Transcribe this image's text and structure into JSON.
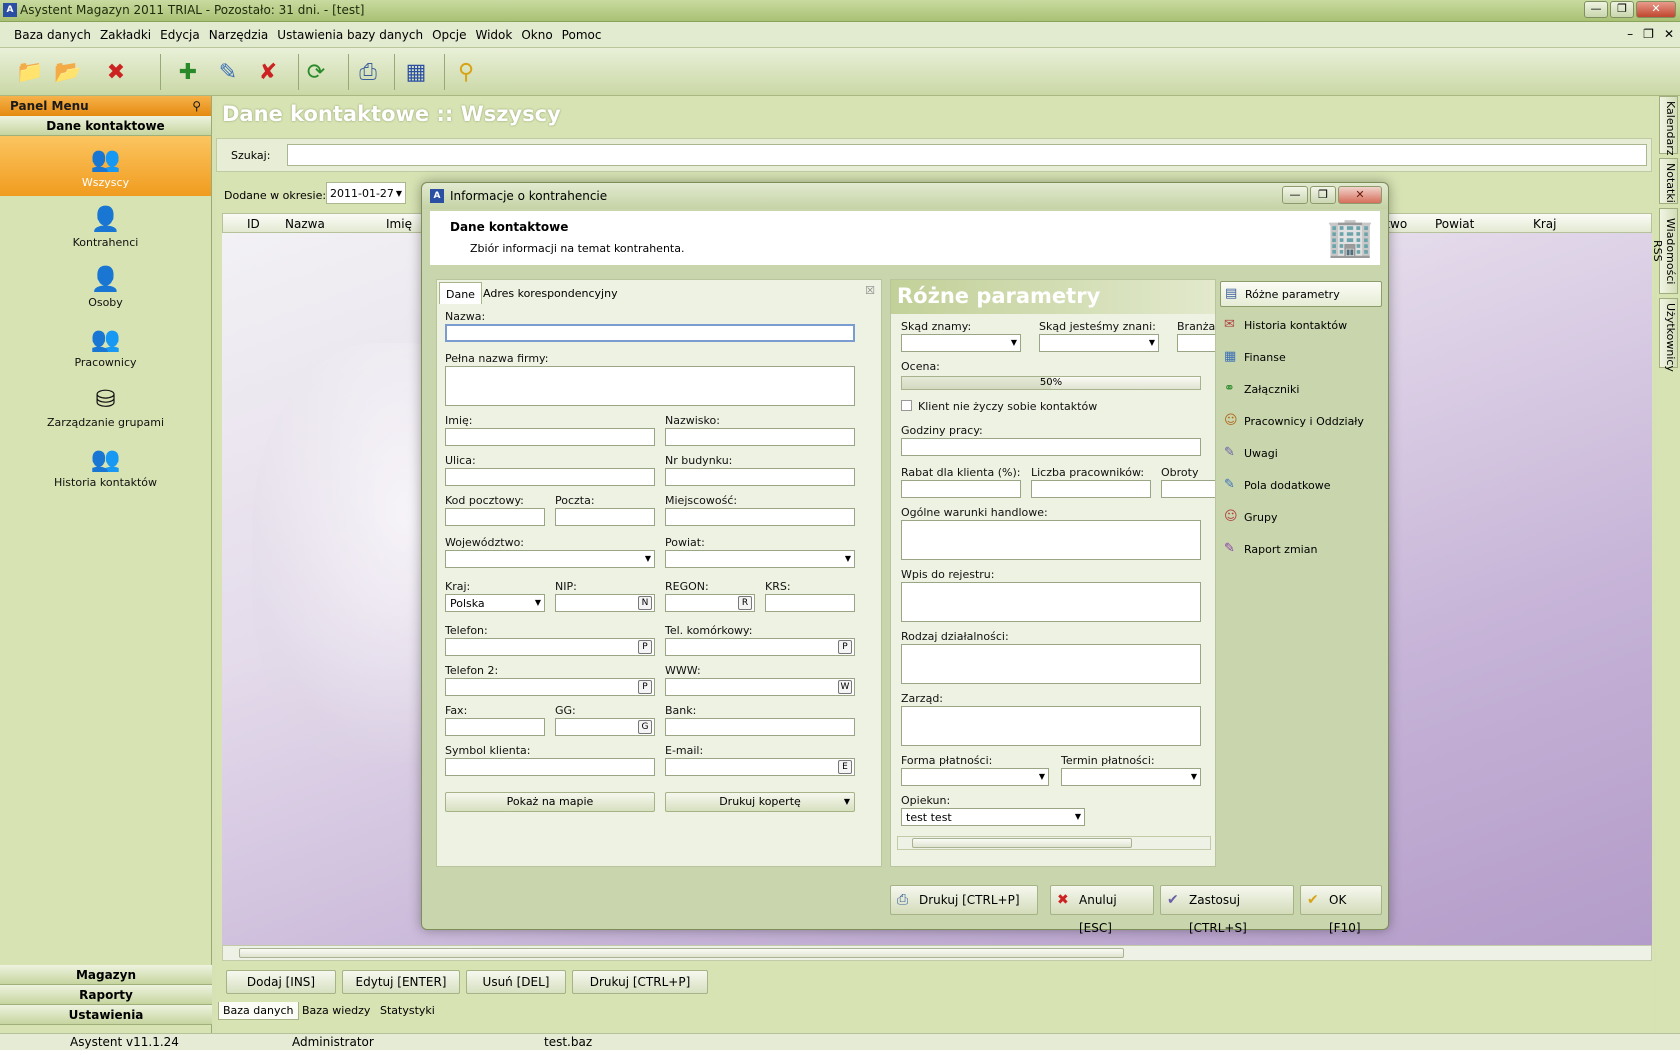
{
  "window": {
    "title": "Asystent Magazyn 2011 TRIAL - Pozostało: 31 dni. - [test]",
    "icon_letter": "A"
  },
  "menu": [
    "Baza danych",
    "Zakładki",
    "Edycja",
    "Narzędzia",
    "Ustawienia bazy danych",
    "Opcje",
    "Widok",
    "Okno",
    "Pomoc"
  ],
  "panel": {
    "title": "Panel Menu",
    "section": "Dane kontaktowe",
    "items": [
      "Wszyscy",
      "Kontrahenci",
      "Osoby",
      "Pracownicy",
      "Zarządzanie grupami",
      "Historia kontaktów"
    ],
    "bottom_sections": [
      "Magazyn",
      "Raporty",
      "Ustawienia"
    ]
  },
  "main": {
    "title": "Dane kontaktowe :: Wszyscy",
    "search_label": "Szukaj:",
    "date_label": "Dodane w okresie:",
    "date_value": "2011-01-27",
    "columns": [
      "ID",
      "Nazwa",
      "Imię",
      "Województwo",
      "Powiat",
      "Kraj"
    ],
    "actions": [
      "Dodaj [INS]",
      "Edytuj [ENTER]",
      "Usuń [DEL]",
      "Drukuj [CTRL+P]"
    ],
    "tabs": [
      "Baza danych",
      "Baza wiedzy",
      "Statystyki"
    ]
  },
  "right_tabs": [
    "Kalendarz",
    "Notatki",
    "Wiadomości RSS",
    "Użytkownicy"
  ],
  "status": {
    "version": "Asystent v11.1.24",
    "user": "Administrator",
    "db": "test.baz"
  },
  "dialog": {
    "title": "Informacje o kontrahencie",
    "header": "Dane kontaktowe",
    "subheader": "Zbiór informacji na temat kontrahenta.",
    "tabs": [
      "Dane",
      "Adres korespondencyjny"
    ],
    "labels": {
      "nazwa": "Nazwa:",
      "pelna": "Pełna nazwa firmy:",
      "imie": "Imię:",
      "nazwisko": "Nazwisko:",
      "ulica": "Ulica:",
      "nr": "Nr budynku:",
      "kod": "Kod pocztowy:",
      "poczta": "Poczta:",
      "miejscowosc": "Miejscowość:",
      "woj": "Województwo:",
      "powiat": "Powiat:",
      "kraj": "Kraj:",
      "nip": "NIP:",
      "regon": "REGON:",
      "krs": "KRS:",
      "tel": "Telefon:",
      "kom": "Tel. komórkowy:",
      "tel2": "Telefon 2:",
      "www": "WWW:",
      "fax": "Fax:",
      "gg": "GG:",
      "bank": "Bank:",
      "symbol": "Symbol klienta:",
      "email": "E-mail:"
    },
    "kraj_value": "Polska",
    "field_buttons": {
      "nip": "N",
      "regon": "R",
      "tel": "P",
      "kom": "P",
      "tel2": "P",
      "www": "W",
      "gg": "G",
      "email": "E"
    },
    "map_button": "Pokaż na mapie",
    "envelope_button": "Drukuj kopertę",
    "params": {
      "title": "Różne parametry",
      "skad_znamy": "Skąd znamy:",
      "skad_znani": "Skąd jesteśmy znani:",
      "branza": "Branża:",
      "ocena": "Ocena:",
      "ocena_value": "50%",
      "ocena_fraction": 0.5,
      "no_contact": "Klient nie życzy sobie kontaktów",
      "godziny": "Godziny pracy:",
      "rabat": "Rabat dla klienta (%):",
      "liczba": "Liczba pracowników:",
      "obroty": "Obroty firm",
      "warunki": "Ogólne warunki handlowe:",
      "wpis": "Wpis do rejestru:",
      "rodzaj": "Rodzaj działalności:",
      "zarzad": "Zarząd:",
      "forma": "Forma płatności:",
      "termin": "Termin płatności:",
      "opiekun": "Opiekun:",
      "opiekun_value": "test test"
    },
    "sidebar": [
      "Różne parametry",
      "Historia kontaktów",
      "Finanse",
      "Załączniki",
      "Pracownicy i Oddziały",
      "Uwagi",
      "Pola dodatkowe",
      "Grupy",
      "Raport zmian"
    ],
    "buttons": [
      "Drukuj [CTRL+P]",
      "Anuluj [ESC]",
      "Zastosuj [CTRL+S]",
      "OK [F10]"
    ]
  }
}
